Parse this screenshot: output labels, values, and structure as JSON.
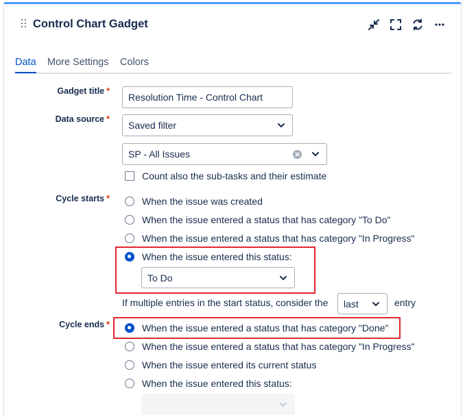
{
  "gadget": {
    "title": "Control Chart Gadget"
  },
  "header_icons": [
    "minimize-icon",
    "fullscreen-icon",
    "refresh-icon",
    "more-icon"
  ],
  "tabs": [
    {
      "label": "Data",
      "active": true
    },
    {
      "label": "More Settings",
      "active": false
    },
    {
      "label": "Colors",
      "active": false
    }
  ],
  "form": {
    "required_marker": "*",
    "gadget_title": {
      "label": "Gadget title",
      "value": "Resolution Time  - Control Chart"
    },
    "data_source": {
      "label": "Data source",
      "type_value": "Saved filter",
      "filter_value": "SP - All Issues",
      "subtasks_label": "Count also the sub-tasks and their estimate",
      "subtasks_checked": false
    },
    "cycle_starts": {
      "label": "Cycle starts",
      "options": [
        "When the issue was created",
        "When the issue entered a status that has category \"To Do\"",
        "When the issue entered a status that has category \"In Progress\"",
        "When the issue entered this status:"
      ],
      "selected_index": 3,
      "status_value": "To Do",
      "multiple_prefix": "If multiple entries in the start status, consider the",
      "multiple_value": "last",
      "multiple_suffix": "entry"
    },
    "cycle_ends": {
      "label": "Cycle ends",
      "options": [
        "When the issue entered a status that has category \"Done\"",
        "When the issue entered a status that has category \"In Progress\"",
        "When the issue entered its current status",
        "When the issue entered this status:"
      ],
      "selected_index": 0,
      "status_value": ""
    }
  },
  "colors": {
    "accent": "#0052cc",
    "highlight": "#e0262f",
    "top_border": "#4c9aff"
  }
}
